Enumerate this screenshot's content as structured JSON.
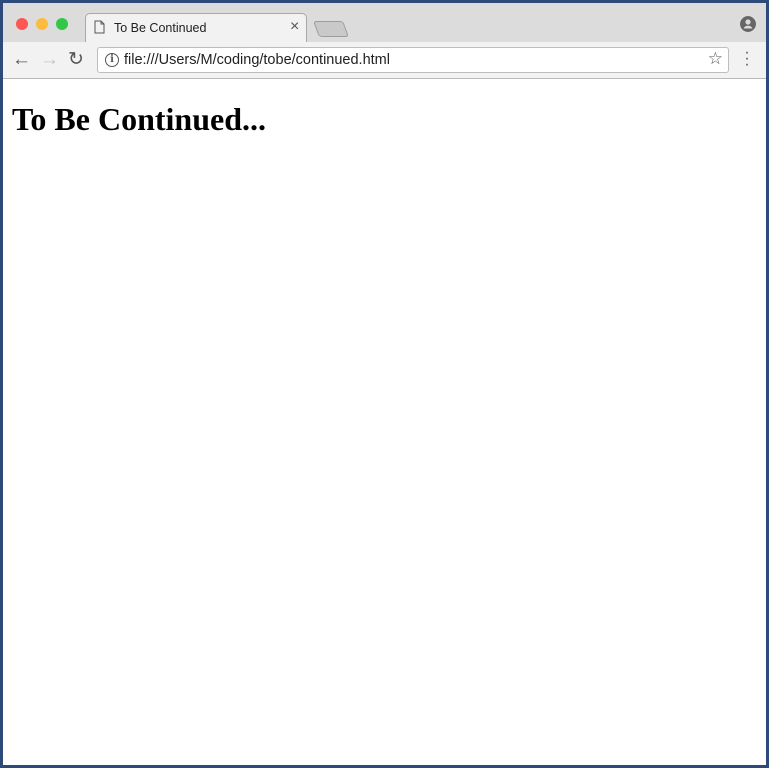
{
  "browser": {
    "tab_title": "To Be Continued",
    "url": "file:///Users/M/coding/tobe/continued.html",
    "icons": [
      "close-window-icon",
      "minimize-icon",
      "zoom-icon",
      "page-icon",
      "close-tab-icon",
      "new-tab-icon",
      "back-icon",
      "forward-icon",
      "reload-icon",
      "info-icon",
      "star-icon",
      "menu-icon",
      "profile-icon"
    ],
    "colors": {
      "close": "#fc5753",
      "minimize": "#fdbc40",
      "zoom": "#33c748",
      "frame": "#2d4a7a"
    }
  },
  "page": {
    "heading": "To Be Continued..."
  }
}
